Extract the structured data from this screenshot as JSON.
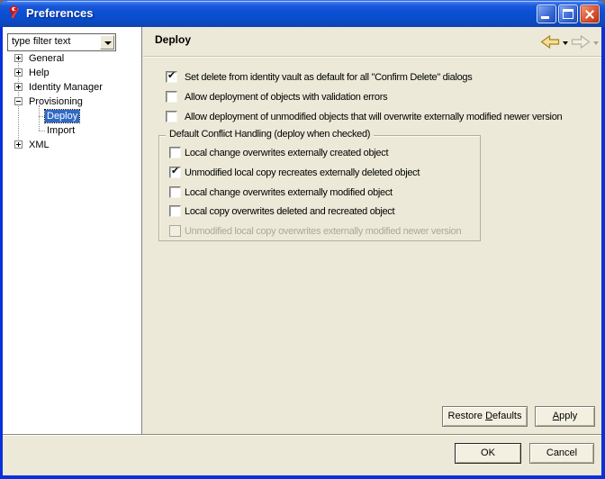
{
  "window": {
    "title": "Preferences"
  },
  "colors": {
    "titlebar_blue": "#0A4FD2",
    "window_border_blue": "#0831D9",
    "dialog_bg": "#ECE9D8",
    "sidebar_bg": "#FFFFFF",
    "selection_blue": "#316AC5",
    "disabled_text": "#ACA899",
    "close_button_red": "#DD5B3A",
    "back_arrow_gold": "#F2DE9C"
  },
  "icons": {
    "app": "designer-compass",
    "check": "✔",
    "expand": "plus-box",
    "collapse": "minus-box",
    "filter_dropdown": "chevron-down",
    "back": "left-arrow",
    "forward": "right-arrow"
  },
  "sidebar": {
    "filter_text": "type filter text",
    "tree": [
      {
        "label": "General",
        "state": "collapsed"
      },
      {
        "label": "Help",
        "state": "collapsed"
      },
      {
        "label": "Identity Manager",
        "state": "collapsed"
      },
      {
        "label": "Provisioning",
        "state": "expanded"
      },
      {
        "label": "Deploy",
        "child": true,
        "selected": true
      },
      {
        "label": "Import",
        "child": true
      },
      {
        "label": "XML",
        "state": "collapsed"
      }
    ]
  },
  "main": {
    "title": "Deploy",
    "checkboxes": [
      {
        "label": "Set delete from identity vault as default for all \"Confirm Delete\" dialogs",
        "checked": true
      },
      {
        "label": "Allow deployment of objects with validation errors",
        "checked": false
      },
      {
        "label": "Allow deployment of unmodified objects that will overwrite externally modified newer version",
        "checked": false
      }
    ],
    "group": {
      "title": "Default Conflict Handling (deploy when checked)",
      "checkboxes": [
        {
          "label": "Local change overwrites externally created object",
          "checked": false
        },
        {
          "label": "Unmodified local copy recreates externally deleted object",
          "checked": true
        },
        {
          "label": "Local change overwrites externally modified object",
          "checked": false
        },
        {
          "label": "Local copy overwrites deleted and recreated object",
          "checked": false
        },
        {
          "label": "Unmodified local copy overwrites externally modified newer version",
          "checked": false,
          "disabled": true
        }
      ]
    },
    "restore_button": {
      "pre": "Restore ",
      "accel": "D",
      "post": "efaults"
    },
    "apply_button": {
      "pre": "",
      "accel": "A",
      "post": "pply"
    }
  },
  "footer": {
    "ok": "OK",
    "cancel": "Cancel"
  }
}
